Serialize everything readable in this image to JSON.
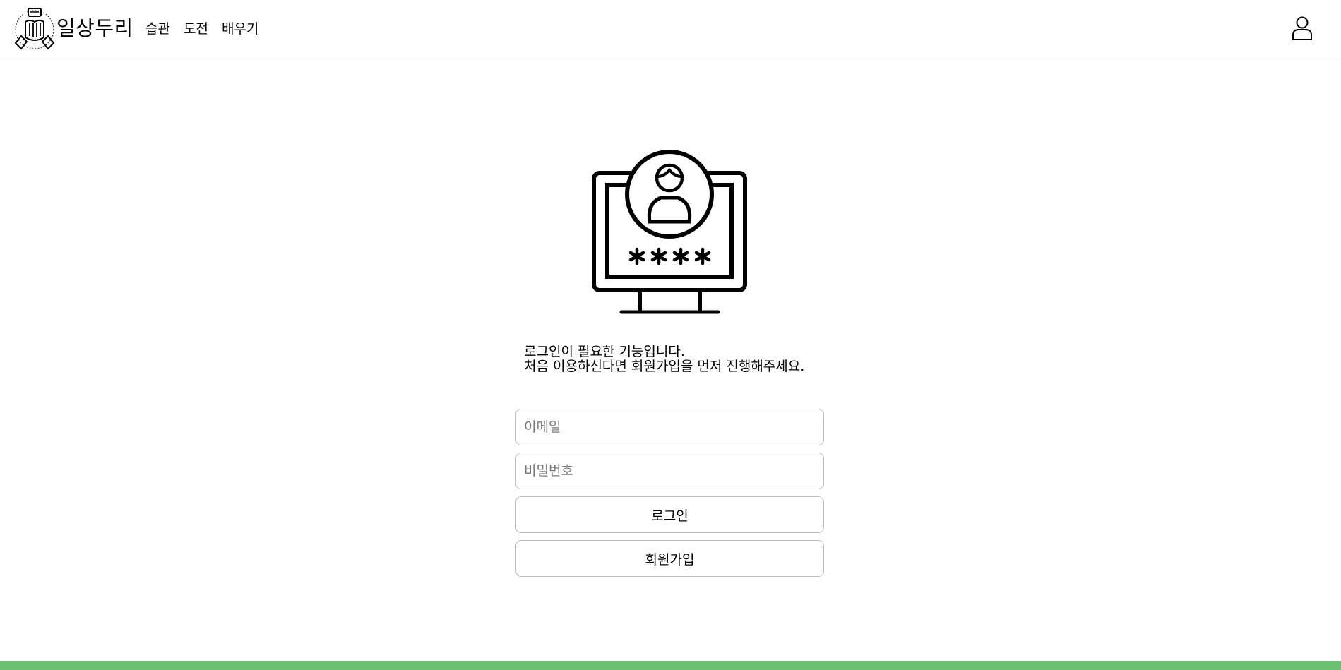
{
  "header": {
    "brand": "일상두리",
    "nav": [
      {
        "label": "습관"
      },
      {
        "label": "도전"
      },
      {
        "label": "배우기"
      }
    ],
    "logo_icon": "hands-together-logo",
    "user_icon": "user-icon"
  },
  "main": {
    "illustration_icon": "monitor-user-password-icon",
    "message_line1": "로그인이 필요한 기능입니다.",
    "message_line2": "처음 이용하신다면 회원가입을 먼저 진행해주세요.",
    "email_placeholder": "이메일",
    "email_value": "",
    "password_placeholder": "비밀번호",
    "password_value": "",
    "login_label": "로그인",
    "signup_label": "회원가입"
  },
  "colors": {
    "footer_bar": "#6dbf74",
    "border": "#bdbdbd",
    "header_divider": "#b5b5b5"
  }
}
